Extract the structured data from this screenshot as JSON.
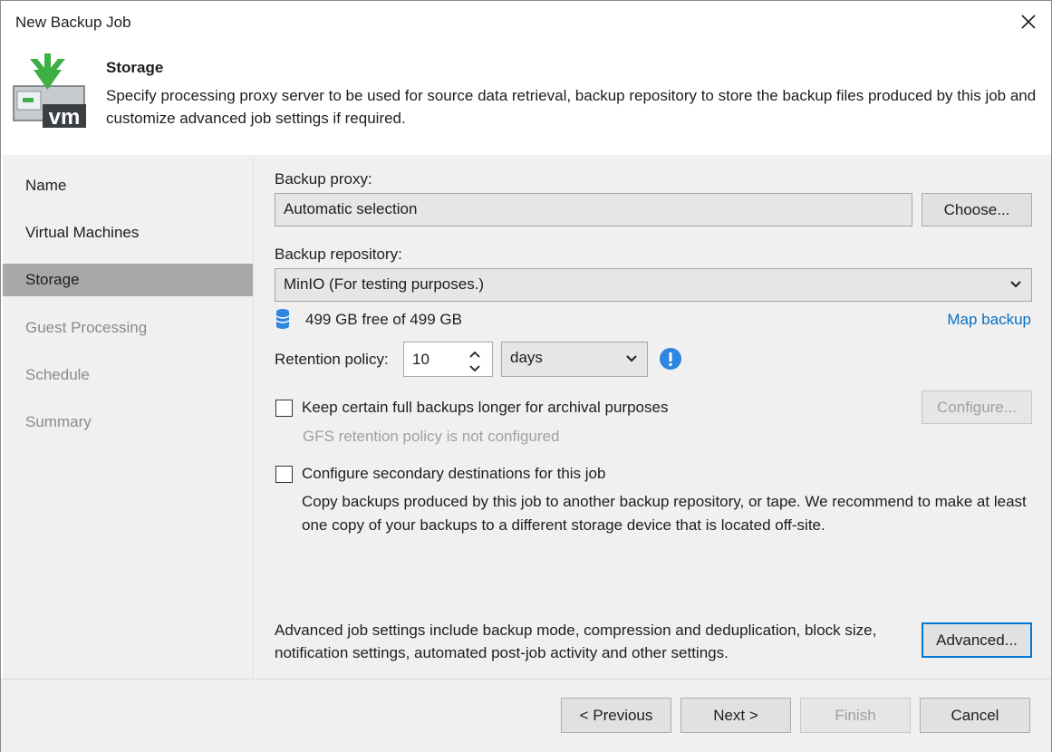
{
  "window": {
    "title": "New Backup Job"
  },
  "header": {
    "title": "Storage",
    "description": "Specify processing proxy server to be used for source data retrieval, backup repository to store the backup files produced by this job and customize advanced job settings if required."
  },
  "nav": {
    "items": [
      {
        "label": "Name",
        "state": "done"
      },
      {
        "label": "Virtual Machines",
        "state": "done"
      },
      {
        "label": "Storage",
        "state": "active"
      },
      {
        "label": "Guest Processing",
        "state": "disabled"
      },
      {
        "label": "Schedule",
        "state": "disabled"
      },
      {
        "label": "Summary",
        "state": "disabled"
      }
    ]
  },
  "proxy": {
    "label": "Backup proxy:",
    "value": "Automatic selection",
    "choose_button": "Choose..."
  },
  "repository": {
    "label": "Backup repository:",
    "value": "MinIO (For testing purposes.)",
    "free_space": "499 GB free of 499 GB",
    "map_backup_link": "Map backup"
  },
  "retention": {
    "label": "Retention policy:",
    "value": "10",
    "unit": "days",
    "info_icon": "info-icon"
  },
  "gfs": {
    "checkbox_label": "Keep certain full backups longer for archival purposes",
    "checked": false,
    "status": "GFS retention policy is not configured",
    "configure_button": "Configure..."
  },
  "secondary": {
    "checkbox_label": "Configure secondary destinations for this job",
    "checked": false,
    "description": "Copy backups produced by this job to another backup repository, or tape. We recommend to make at least one copy of your backups to a different storage device that is located off-site."
  },
  "advanced": {
    "description": "Advanced job settings include backup mode, compression and deduplication, block size, notification settings, automated post-job activity and other settings.",
    "button": "Advanced..."
  },
  "footer": {
    "previous": "< Previous",
    "next": "Next >",
    "finish": "Finish",
    "cancel": "Cancel"
  },
  "colors": {
    "accent": "#0078d7",
    "link": "#0a6fc2",
    "icon_green": "#3cb043",
    "info_blue": "#2e86de"
  }
}
